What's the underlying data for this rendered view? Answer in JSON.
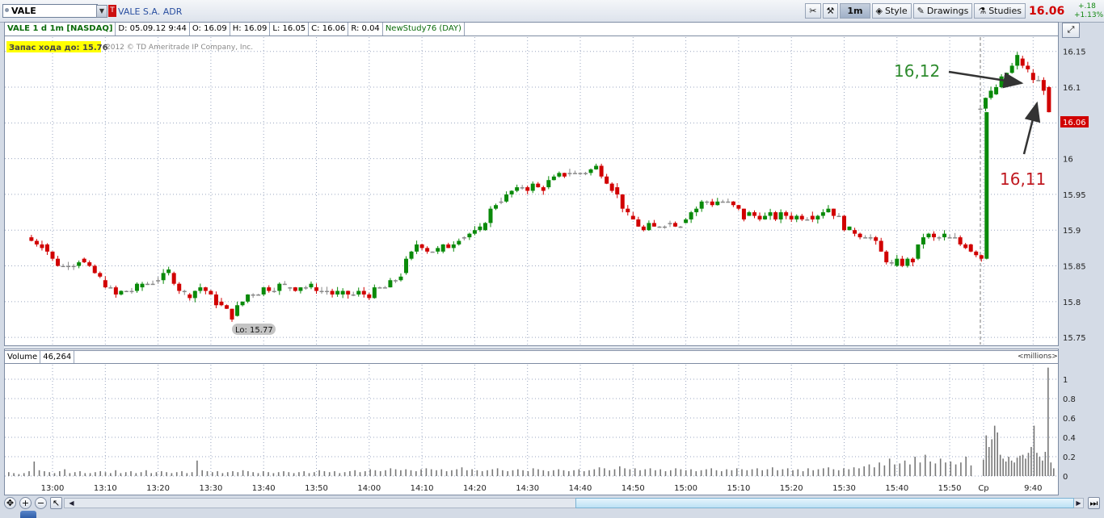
{
  "toolbar": {
    "symbol": "VALE",
    "exchange_icon": "T",
    "description": "VALE S.A. ADR",
    "buttons": {
      "interval": "1m",
      "style": "Style",
      "drawings": "Drawings",
      "studies": "Studies"
    },
    "last_price": "16.06",
    "change_abs": "+.18",
    "change_pct": "+1.13%"
  },
  "header": {
    "title": "VALE 1 d 1m [NASDAQ]",
    "date": "D: 05.09.12 9:44",
    "open": "O: 16.09",
    "high": "H: 16.09",
    "low": "L: 16.05",
    "close": "C: 16.06",
    "range": "R: 0.04",
    "study": "NewStudy76 (DAY)"
  },
  "overlay": {
    "badge": "Запас хода до: 15.76",
    "copyright": "2012 © TD Ameritrade IP Company, Inc.",
    "lo_label": "Lo: 15.77",
    "price_tag": "16.06",
    "annotation_green": "16,12",
    "annotation_red": "16,11"
  },
  "volume_header": {
    "title": "Volume",
    "value": "46,264",
    "units": "<millions>"
  },
  "colors": {
    "up": "#0a8a0a",
    "down": "#d10000",
    "grid": "#9aa6c0",
    "annotation_green": "#2e8b2e",
    "annotation_red": "#c0181f"
  },
  "icons": {
    "nav": [
      "pan-icon",
      "zoom-in-icon",
      "zoom-out-icon",
      "pointer-icon"
    ],
    "toolbar": [
      "crosshair-icon",
      "wrench-icon",
      "style-icon",
      "drawings-icon",
      "studies-icon"
    ]
  },
  "chart_data": [
    {
      "type": "candlestick",
      "title": "",
      "y_ticks": [
        15.75,
        15.8,
        15.85,
        15.9,
        15.95,
        16,
        16.05,
        16.1,
        16.15
      ],
      "ylim": [
        15.74,
        16.17
      ],
      "x_ticks": [
        "13:00",
        "13:10",
        "13:20",
        "13:30",
        "13:40",
        "13:50",
        "14:00",
        "14:10",
        "14:20",
        "14:30",
        "14:40",
        "14:50",
        "15:00",
        "15:10",
        "15:20",
        "15:30",
        "15:40",
        "15:50",
        "Cp",
        "9:40"
      ],
      "grid": true,
      "anchors": [
        [
          "12:56",
          15.89
        ],
        [
          "12:59",
          15.88
        ],
        [
          "13:01",
          15.86
        ],
        [
          "13:03",
          15.85
        ],
        [
          "13:06",
          15.86
        ],
        [
          "13:10",
          15.83
        ],
        [
          "13:13",
          15.81
        ],
        [
          "13:17",
          15.82
        ],
        [
          "13:20",
          15.83
        ],
        [
          "13:23",
          15.84
        ],
        [
          "13:26",
          15.81
        ],
        [
          "13:29",
          15.82
        ],
        [
          "13:32",
          15.8
        ],
        [
          "13:35",
          15.78
        ],
        [
          "13:38",
          15.81
        ],
        [
          "13:41",
          15.82
        ],
        [
          "13:45",
          15.82
        ],
        [
          "13:50",
          15.82
        ],
        [
          "13:55",
          15.81
        ],
        [
          "14:00",
          15.81
        ],
        [
          "14:04",
          15.82
        ],
        [
          "14:07",
          15.84
        ],
        [
          "14:10",
          15.88
        ],
        [
          "14:14",
          15.87
        ],
        [
          "14:18",
          15.89
        ],
        [
          "14:22",
          15.9
        ],
        [
          "14:25",
          15.94
        ],
        [
          "14:30",
          15.96
        ],
        [
          "14:34",
          15.96
        ],
        [
          "14:38",
          15.98
        ],
        [
          "14:42",
          15.98
        ],
        [
          "14:44",
          15.99
        ],
        [
          "14:47",
          15.96
        ],
        [
          "14:50",
          15.92
        ],
        [
          "14:53",
          15.9
        ],
        [
          "14:57",
          15.91
        ],
        [
          "15:00",
          15.91
        ],
        [
          "15:04",
          15.94
        ],
        [
          "15:08",
          15.94
        ],
        [
          "15:12",
          15.92
        ],
        [
          "15:16",
          15.92
        ],
        [
          "15:20",
          15.92
        ],
        [
          "15:24",
          15.92
        ],
        [
          "15:28",
          15.93
        ],
        [
          "15:32",
          15.9
        ],
        [
          "15:36",
          15.89
        ],
        [
          "15:40",
          15.85
        ],
        [
          "15:44",
          15.86
        ],
        [
          "15:46",
          15.89
        ],
        [
          "15:50",
          15.89
        ],
        [
          "15:54",
          15.88
        ],
        [
          "15:57",
          15.86
        ],
        [
          "9:30",
          16.07
        ],
        [
          "9:33",
          16.09
        ],
        [
          "9:36",
          16.12
        ],
        [
          "9:38",
          16.14
        ],
        [
          "9:40",
          16.12
        ],
        [
          "9:43",
          16.1
        ],
        [
          "9:44",
          16.06
        ]
      ],
      "session_high": 16.16,
      "session_low": 15.77,
      "last": 16.06
    },
    {
      "type": "bar",
      "title": "Volume",
      "units": "millions",
      "y_ticks": [
        0,
        0.2,
        0.4,
        0.6,
        0.8,
        1
      ],
      "ylim": [
        0,
        1.15
      ],
      "values_millions": [
        0.04,
        0.03,
        0.02,
        0.03,
        0.05,
        0.15,
        0.06,
        0.05,
        0.04,
        0.03,
        0.05,
        0.07,
        0.03,
        0.04,
        0.05,
        0.03,
        0.03,
        0.04,
        0.05,
        0.04,
        0.03,
        0.06,
        0.03,
        0.04,
        0.05,
        0.03,
        0.04,
        0.06,
        0.03,
        0.04,
        0.05,
        0.04,
        0.03,
        0.04,
        0.05,
        0.03,
        0.04,
        0.16,
        0.06,
        0.05,
        0.04,
        0.05,
        0.03,
        0.04,
        0.05,
        0.04,
        0.06,
        0.05,
        0.04,
        0.03,
        0.05,
        0.04,
        0.03,
        0.04,
        0.05,
        0.04,
        0.03,
        0.04,
        0.05,
        0.03,
        0.04,
        0.06,
        0.05,
        0.04,
        0.05,
        0.03,
        0.04,
        0.05,
        0.06,
        0.04,
        0.05,
        0.07,
        0.06,
        0.05,
        0.06,
        0.08,
        0.07,
        0.06,
        0.07,
        0.06,
        0.05,
        0.07,
        0.08,
        0.07,
        0.06,
        0.07,
        0.05,
        0.06,
        0.07,
        0.09,
        0.06,
        0.07,
        0.06,
        0.05,
        0.06,
        0.07,
        0.08,
        0.06,
        0.05,
        0.06,
        0.07,
        0.06,
        0.05,
        0.08,
        0.07,
        0.06,
        0.05,
        0.06,
        0.07,
        0.06,
        0.05,
        0.06,
        0.07,
        0.05,
        0.06,
        0.07,
        0.09,
        0.08,
        0.06,
        0.07,
        0.1,
        0.08,
        0.07,
        0.08,
        0.06,
        0.07,
        0.08,
        0.06,
        0.07,
        0.05,
        0.06,
        0.08,
        0.07,
        0.06,
        0.07,
        0.05,
        0.06,
        0.07,
        0.08,
        0.06,
        0.05,
        0.07,
        0.06,
        0.08,
        0.07,
        0.06,
        0.07,
        0.08,
        0.06,
        0.07,
        0.09,
        0.06,
        0.07,
        0.08,
        0.06,
        0.07,
        0.05,
        0.08,
        0.06,
        0.07,
        0.08,
        0.09,
        0.07,
        0.06,
        0.08,
        0.07,
        0.09,
        0.08,
        0.1,
        0.12,
        0.09,
        0.14,
        0.11,
        0.18,
        0.12,
        0.13,
        0.16,
        0.12,
        0.2,
        0.14,
        0.22,
        0.15,
        0.13,
        0.18,
        0.14,
        0.15,
        0.12,
        0.14,
        0.2,
        0.11,
        0.17,
        0.42,
        0.3,
        0.38,
        0.52,
        0.45,
        0.22,
        0.18,
        0.15,
        0.2,
        0.16,
        0.14,
        0.19,
        0.21,
        0.22,
        0.18,
        0.24,
        0.3,
        0.52,
        0.24,
        0.2,
        0.16,
        0.25,
        1.12,
        0.14,
        0.08
      ]
    }
  ]
}
